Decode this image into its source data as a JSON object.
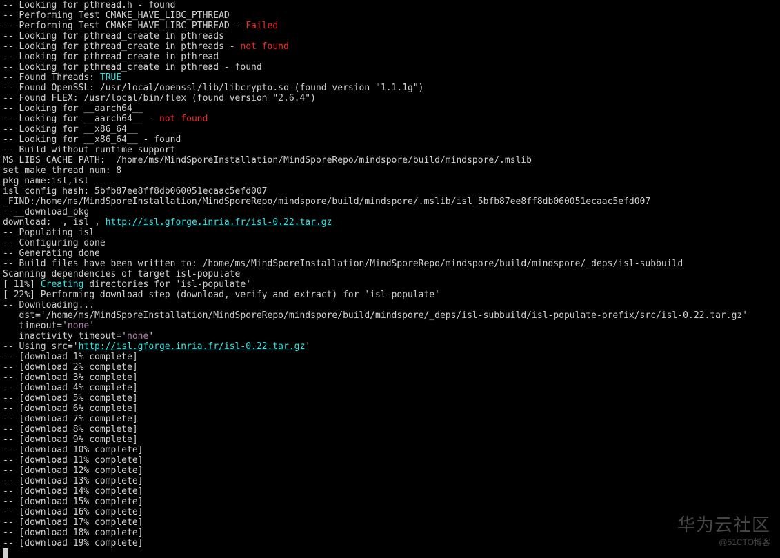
{
  "lines": [
    [
      {
        "t": "-- Looking for pthread.h - found"
      }
    ],
    [
      {
        "t": "-- Performing Test CMAKE_HAVE_LIBC_PTHREAD"
      }
    ],
    [
      {
        "t": "-- Performing Test CMAKE_HAVE_LIBC_PTHREAD - "
      },
      {
        "t": "Failed",
        "cls": "red"
      }
    ],
    [
      {
        "t": "-- Looking for pthread_create in pthreads"
      }
    ],
    [
      {
        "t": "-- Looking for pthread_create in pthreads - "
      },
      {
        "t": "not found",
        "cls": "red"
      }
    ],
    [
      {
        "t": "-- Looking for pthread_create in pthread"
      }
    ],
    [
      {
        "t": "-- Looking for pthread_create in pthread - found"
      }
    ],
    [
      {
        "t": "-- Found Threads: "
      },
      {
        "t": "TRUE",
        "cls": "cyan"
      }
    ],
    [
      {
        "t": "-- Found OpenSSL: /usr/local/openssl/lib/libcrypto.so (found version \"1.1.1g\")"
      }
    ],
    [
      {
        "t": "-- Found FLEX: /usr/local/bin/flex (found version \"2.6.4\")"
      }
    ],
    [
      {
        "t": "-- Looking for __aarch64__"
      }
    ],
    [
      {
        "t": "-- Looking for __aarch64__ - "
      },
      {
        "t": "not found",
        "cls": "red"
      }
    ],
    [
      {
        "t": "-- Looking for __x86_64__"
      }
    ],
    [
      {
        "t": "-- Looking for __x86_64__ - found"
      }
    ],
    [
      {
        "t": "-- Build without runtime support"
      }
    ],
    [
      {
        "t": "MS LIBS CACHE PATH:  /home/ms/MindSporeInstallation/MindSporeRepo/mindspore/build/mindspore/.mslib"
      }
    ],
    [
      {
        "t": "set make thread num: 8"
      }
    ],
    [
      {
        "t": "pkg name:isl,isl"
      }
    ],
    [
      {
        "t": "isl config hash: 5bfb87ee8ff8db060051ecaac5efd007"
      }
    ],
    [
      {
        "t": "_FIND:/home/ms/MindSporeInstallation/MindSporeRepo/mindspore/build/mindspore/.mslib/isl_5bfb87ee8ff8db060051ecaac5efd007"
      }
    ],
    [
      {
        "t": "--__download_pkg"
      }
    ],
    [
      {
        "t": "download:  , isl , "
      },
      {
        "t": "http://isl.gforge.inria.fr/isl-0.22.tar.gz",
        "cls": "uline"
      }
    ],
    [
      {
        "t": "-- Populating isl"
      }
    ],
    [
      {
        "t": "-- Configuring done"
      }
    ],
    [
      {
        "t": "-- Generating done"
      }
    ],
    [
      {
        "t": "-- Build files have been written to: /home/ms/MindSporeInstallation/MindSporeRepo/mindspore/build/mindspore/_deps/isl-subbuild"
      }
    ],
    [
      {
        "t": "Scanning dependencies of target isl-populate"
      }
    ],
    [
      {
        "t": "[ 11%] "
      },
      {
        "t": "Creating",
        "cls": "cyan"
      },
      {
        "t": " directories for 'isl-populate'"
      }
    ],
    [
      {
        "t": "[ 22%] Performing download step (download, verify and extract) for 'isl-populate'"
      }
    ],
    [
      {
        "t": "-- Downloading..."
      }
    ],
    [
      {
        "t": "   dst='/home/ms/MindSporeInstallation/MindSporeRepo/mindspore/build/mindspore/_deps/isl-subbuild/isl-populate-prefix/src/isl-0.22.tar.gz'"
      }
    ],
    [
      {
        "t": "   timeout='"
      },
      {
        "t": "none",
        "cls": "purple"
      },
      {
        "t": "'"
      }
    ],
    [
      {
        "t": "   inactivity timeout='"
      },
      {
        "t": "none",
        "cls": "purple"
      },
      {
        "t": "'"
      }
    ],
    [
      {
        "t": "-- Using src='"
      },
      {
        "t": "http://isl.gforge.inria.fr/isl-0.22.tar.gz",
        "cls": "uline"
      },
      {
        "t": "'"
      }
    ],
    [
      {
        "t": "-- [download 1% complete]"
      }
    ],
    [
      {
        "t": "-- [download 2% complete]"
      }
    ],
    [
      {
        "t": "-- [download 3% complete]"
      }
    ],
    [
      {
        "t": "-- [download 4% complete]"
      }
    ],
    [
      {
        "t": "-- [download 5% complete]"
      }
    ],
    [
      {
        "t": "-- [download 6% complete]"
      }
    ],
    [
      {
        "t": "-- [download 7% complete]"
      }
    ],
    [
      {
        "t": "-- [download 8% complete]"
      }
    ],
    [
      {
        "t": "-- [download 9% complete]"
      }
    ],
    [
      {
        "t": "-- [download 10% complete]"
      }
    ],
    [
      {
        "t": "-- [download 11% complete]"
      }
    ],
    [
      {
        "t": "-- [download 12% complete]"
      }
    ],
    [
      {
        "t": "-- [download 13% complete]"
      }
    ],
    [
      {
        "t": "-- [download 14% complete]"
      }
    ],
    [
      {
        "t": "-- [download 15% complete]"
      }
    ],
    [
      {
        "t": "-- [download 16% complete]"
      }
    ],
    [
      {
        "t": "-- [download 17% complete]"
      }
    ],
    [
      {
        "t": "-- [download 18% complete]"
      }
    ],
    [
      {
        "t": "-- [download 19% complete]"
      }
    ]
  ],
  "watermark": {
    "main": "华为云社区",
    "sub": "@51CTO博客"
  }
}
